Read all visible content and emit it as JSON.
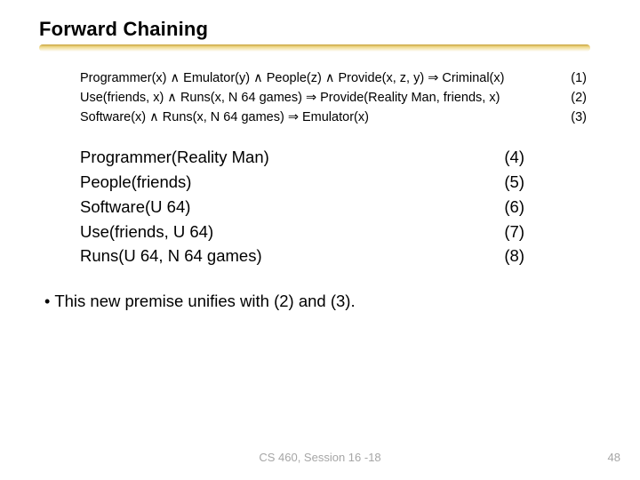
{
  "title": "Forward Chaining",
  "premises": [
    {
      "text": "Programmer(x) ∧ Emulator(y) ∧ People(z) ∧ Provide(x, z, y) ⇒ Criminal(x)",
      "num": "(1)"
    },
    {
      "text": "Use(friends, x) ∧ Runs(x, N 64 games) ⇒ Provide(Reality Man, friends, x)",
      "num": "(2)"
    },
    {
      "text": "Software(x) ∧ Runs(x, N 64 games) ⇒ Emulator(x)",
      "num": "(3)"
    }
  ],
  "facts": [
    {
      "text": "Programmer(Reality Man)",
      "num": "(4)"
    },
    {
      "text": "People(friends)",
      "num": "(5)"
    },
    {
      "text": "Software(U 64)",
      "num": "(6)"
    },
    {
      "text": "Use(friends, U 64)",
      "num": "(7)"
    },
    {
      "text": "Runs(U 64, N 64 games)",
      "num": "(8)"
    }
  ],
  "bullet": "This new premise unifies with (2) and (3).",
  "footer": {
    "center": "CS 460, Session 16 -18",
    "num": "48"
  }
}
